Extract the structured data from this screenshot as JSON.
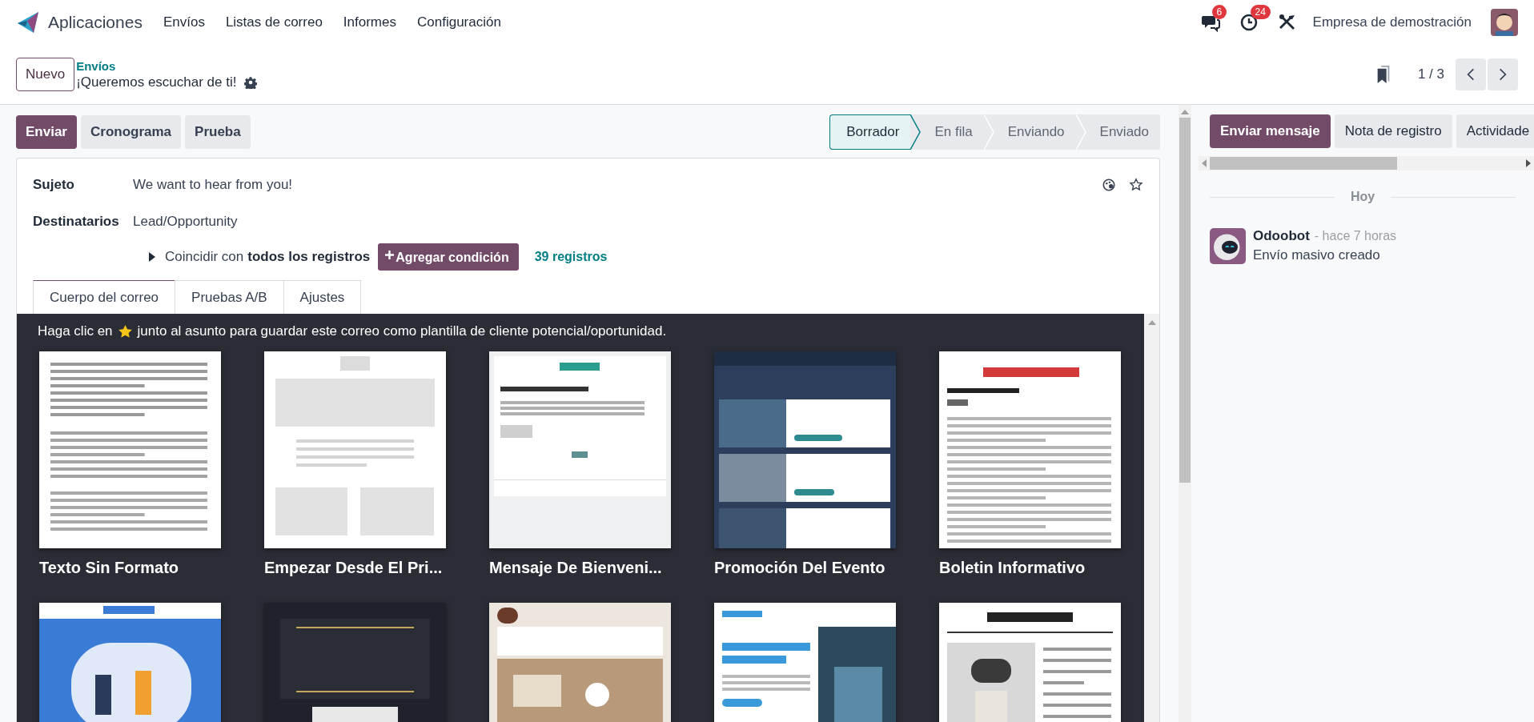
{
  "navbar": {
    "app": "Aplicaciones",
    "menu": [
      "Envíos",
      "Listas de correo",
      "Informes",
      "Configuración"
    ],
    "chat_badge": "6",
    "activity_badge": "24",
    "company": "Empresa de demostración"
  },
  "breadcrumb": {
    "new_button": "Nuevo",
    "parent": "Envíos",
    "current": "¡Queremos escuchar de ti!"
  },
  "pager": {
    "value": "1 / 3"
  },
  "actions": [
    {
      "label": "Enviar",
      "primary": true
    },
    {
      "label": "Cronograma",
      "primary": false
    },
    {
      "label": "Prueba",
      "primary": false
    }
  ],
  "status_steps": [
    {
      "label": "Borrador",
      "selected": true
    },
    {
      "label": "En fila",
      "selected": false
    },
    {
      "label": "Enviando",
      "selected": false
    },
    {
      "label": "Enviado",
      "selected": false
    }
  ],
  "form": {
    "subject_label": "Sujeto",
    "subject": "We want to hear from you!",
    "recipients_label": "Destinatarios",
    "recipients": "Lead/Opportunity",
    "match_prefix": "Coincidir con",
    "match_bold": "todos los registros",
    "add_condition": "Agregar condición",
    "records": "39 registros"
  },
  "tabs": [
    {
      "label": "Cuerpo del correo",
      "selected": true
    },
    {
      "label": "Pruebas A/B",
      "selected": false
    },
    {
      "label": "Ajustes",
      "selected": false
    }
  ],
  "templates": {
    "hint_before": "Haga clic en",
    "hint_after": "junto al asunto para guardar este correo como plantilla de cliente potencial/oportunidad.",
    "items": [
      {
        "name": "Texto Sin Formato",
        "kind": "text"
      },
      {
        "name": "Empezar Desde El Pri...",
        "kind": "blank"
      },
      {
        "name": "Mensaje De Bienveni...",
        "kind": "welcome"
      },
      {
        "name": "Promoción Del Evento",
        "kind": "event"
      },
      {
        "name": "Boletin Informativo",
        "kind": "newsletter"
      },
      {
        "kind": "training"
      },
      {
        "kind": "vip"
      },
      {
        "kind": "news"
      },
      {
        "kind": "tech"
      },
      {
        "kind": "daily"
      }
    ]
  },
  "chatter": {
    "buttons": [
      {
        "label": "Enviar mensaje",
        "primary": true
      },
      {
        "label": "Nota de registro",
        "primary": false
      },
      {
        "label": "Actividade",
        "primary": false
      }
    ],
    "date_separator": "Hoy",
    "message": {
      "author": "Odoobot",
      "time": "- hace 7 horas",
      "body": "Envío masivo creado"
    }
  }
}
